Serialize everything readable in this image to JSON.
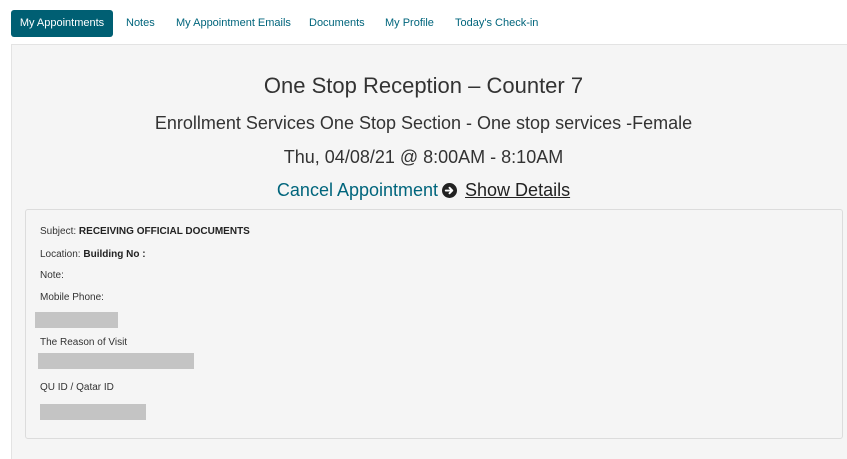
{
  "nav": {
    "tabs": [
      {
        "label": "My Appointments",
        "active": true
      },
      {
        "label": "Notes",
        "active": false
      },
      {
        "label": "My Appointment Emails",
        "active": false
      },
      {
        "label": "Documents",
        "active": false
      },
      {
        "label": "My Profile",
        "active": false
      },
      {
        "label": "Today's Check-in",
        "active": false
      }
    ]
  },
  "appointment": {
    "title": "One Stop Reception – Counter 7",
    "service": "Enrollment Services One Stop Section - One stop services -Female",
    "datetime": "Thu, 04/08/21 @ 8:00AM - 8:10AM",
    "cancel_label": "Cancel Appointment",
    "show_details_label": "Show Details"
  },
  "details": {
    "subject_label": "Subject:",
    "subject_value": "RECEIVING OFFICIAL DOCUMENTS",
    "location_label": "Location:",
    "location_value": "Building No :",
    "note_label": "Note:",
    "mobile_label": "Mobile Phone:",
    "reason_label": "The Reason of Visit",
    "qu_id_label": "QU ID / Qatar ID"
  },
  "colors": {
    "accent": "#005f73",
    "link": "#00657c",
    "panel_bg": "#f5f5f5",
    "redaction": "#c4c4c4"
  },
  "icons": {
    "cancel": "arrow-circle-right-icon"
  }
}
